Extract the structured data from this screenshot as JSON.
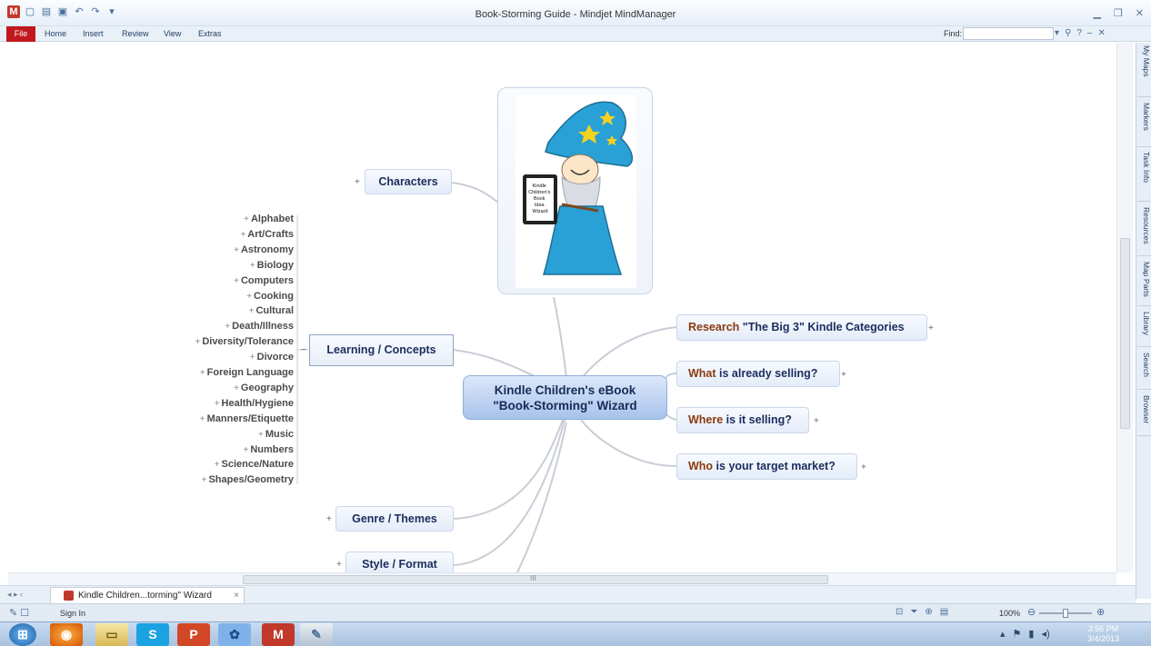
{
  "window": {
    "title": "Book-Storming Guide - Mindjet MindManager"
  },
  "ribbon": {
    "file": "File",
    "tabs": [
      "Home",
      "Insert",
      "Review",
      "View",
      "Extras"
    ],
    "find_label": "Find:",
    "find_value": ""
  },
  "map": {
    "central": {
      "line1": "Kindle Children's eBook",
      "line2": "\"Book-Storming\" Wizard"
    },
    "wizard_badge": [
      "Kindle",
      "Children's",
      "Book",
      "Idea",
      "Wizard"
    ],
    "left_topics": {
      "characters": "Characters",
      "learning": "Learning / Concepts",
      "genre": "Genre / Themes",
      "style": "Style / Format"
    },
    "learning_subtopics": [
      "Alphabet",
      "Art/Crafts",
      "Astronomy",
      "Biology",
      "Computers",
      "Cooking",
      "Cultural",
      "Death/Illness",
      "Diversity/Tolerance",
      "Divorce",
      "Foreign Language",
      "Geography",
      "Health/Hygiene",
      "Manners/Etiquette",
      "Music",
      "Numbers",
      "Science/Nature",
      "Shapes/Geometry"
    ],
    "right_topics": {
      "research": {
        "hl": "Research",
        "rest": " \"The Big 3\" Kindle Categories"
      },
      "what": {
        "hl": "What",
        "rest": " is already selling?"
      },
      "where": {
        "hl": "Where",
        "rest": " is it selling?"
      },
      "who": {
        "hl": "Who",
        "rest": " is your target market?"
      }
    },
    "scroll_mark": "III"
  },
  "right_panel": [
    "My Maps",
    "Markers",
    "Task Info",
    "Resources",
    "Map Parts",
    "Library",
    "Search",
    "Browser"
  ],
  "doc_tab": {
    "label": "Kindle Children...torming\" Wizard"
  },
  "status": {
    "signin": "Sign In",
    "zoom": "100%"
  },
  "taskbar": {
    "time": "3:56 PM",
    "date": "3/4/2013",
    "mindjet_letter": "M",
    "skype_letter": "S",
    "ppt_letter": "P"
  },
  "colors": {
    "topic_text": "#1b2d5c",
    "highlight": "#8b3a0f",
    "central_fill": "#b9d0ee",
    "file_tab": "#c0181e"
  }
}
